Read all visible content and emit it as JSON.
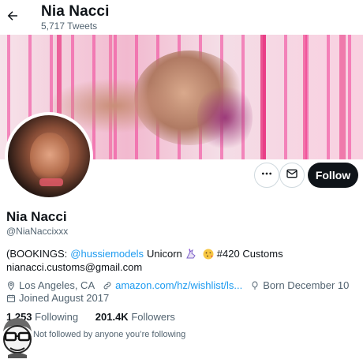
{
  "header": {
    "name": "Nia Nacci",
    "tweet_count": "5,717 Tweets"
  },
  "profile": {
    "name": "Nia Nacci",
    "handle": "@NiaNaccixxx",
    "follow_label": "Follow",
    "bio": {
      "prefix": "(BOOKINGS:",
      "mention": "@hussiemodels",
      "after_mention": "Unicorn",
      "after_emoji": "#420 Customs",
      "line2": "nianacci.customs@gmail.com"
    },
    "location": "Los Angeles, CA",
    "website": "amazon.com/hz/wishlist/ls...",
    "birth": "Born December 10",
    "joined": "Joined August 2017",
    "following_count": "1,253",
    "following_label": "Following",
    "followers_count": "201.4K",
    "followers_label": "Followers",
    "followed_by": "Not followed by anyone you’re following"
  },
  "colors": {
    "accent": "#1d9bf0",
    "text": "#0f1419",
    "muted": "#536471",
    "follow_bg": "#0f1419"
  },
  "icons": [
    "back-arrow-icon",
    "more-icon",
    "mail-icon",
    "location-icon",
    "link-icon",
    "balloon-icon",
    "calendar-icon",
    "unicorn-emoji",
    "kiss-emoji"
  ]
}
